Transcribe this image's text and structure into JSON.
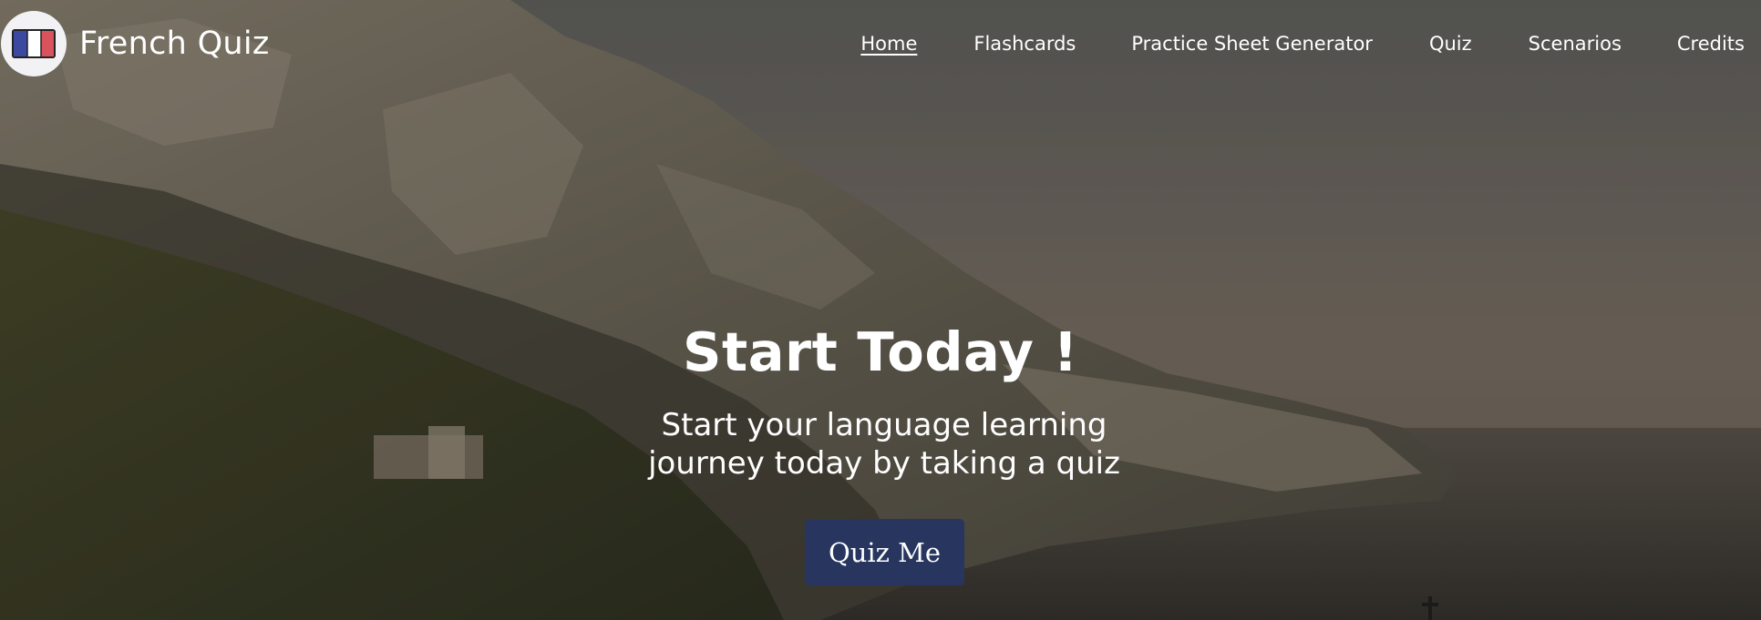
{
  "site": {
    "title": "French Quiz",
    "logo_icon": "french-flag-icon"
  },
  "nav": {
    "items": [
      {
        "label": "Home",
        "active": true
      },
      {
        "label": "Flashcards"
      },
      {
        "label": "Practice Sheet Generator"
      },
      {
        "label": "Quiz"
      },
      {
        "label": "Scenarios"
      },
      {
        "label": "Credits"
      }
    ]
  },
  "hero": {
    "headline": "Start Today !",
    "subtext": "Start your language learning journey today by taking a quiz",
    "cta_label": "Quiz Me"
  },
  "colors": {
    "cta_background": "#28365f",
    "text": "#ffffff",
    "flag_blue": "#3b4aa0",
    "flag_red": "#d9535e"
  }
}
